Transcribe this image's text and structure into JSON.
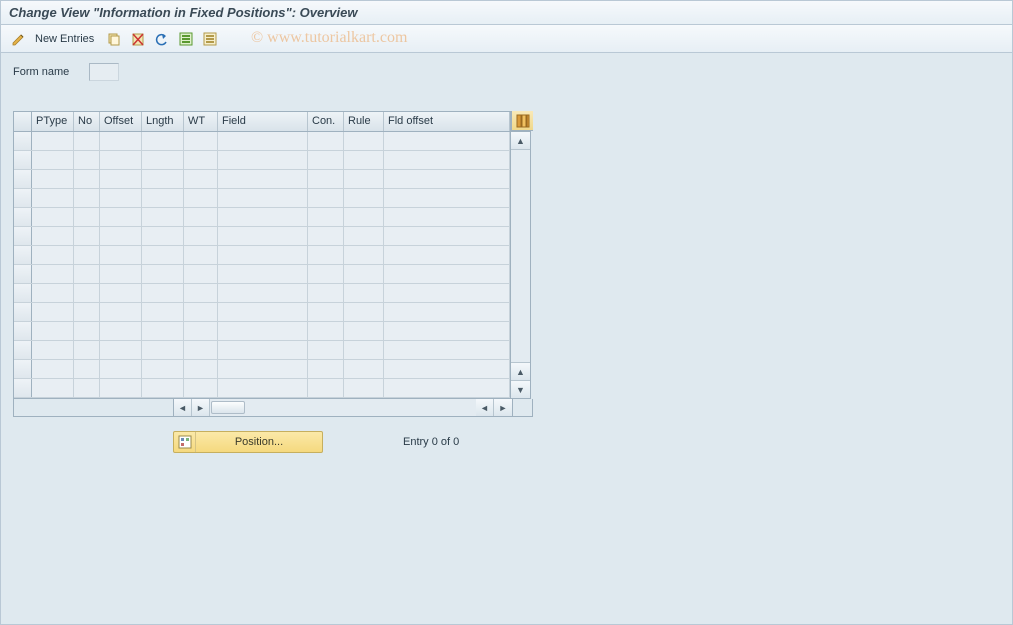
{
  "header": {
    "title": "Change View \"Information in Fixed Positions\": Overview"
  },
  "toolbar": {
    "new_entries_label": "New Entries",
    "icons": {
      "edit": "pencil-icon",
      "copy": "copy-icon",
      "delete": "delete-icon",
      "undo": "undo-icon",
      "select_all": "select-all-icon",
      "deselect_all": "deselect-all-icon"
    }
  },
  "form": {
    "form_name_label": "Form name",
    "form_name_value": ""
  },
  "table": {
    "columns": {
      "ptype": "PType",
      "no": "No",
      "offset": "Offset",
      "lngth": "Lngth",
      "wt": "WT",
      "field": "Field",
      "con": "Con.",
      "rule": "Rule",
      "fld_offset": "Fld offset"
    },
    "rows": [
      {},
      {},
      {},
      {},
      {},
      {},
      {},
      {},
      {},
      {},
      {},
      {},
      {},
      {}
    ]
  },
  "footer": {
    "position_label": "Position...",
    "entry_status": "Entry 0 of 0"
  },
  "watermark": "© www.tutorialkart.com"
}
